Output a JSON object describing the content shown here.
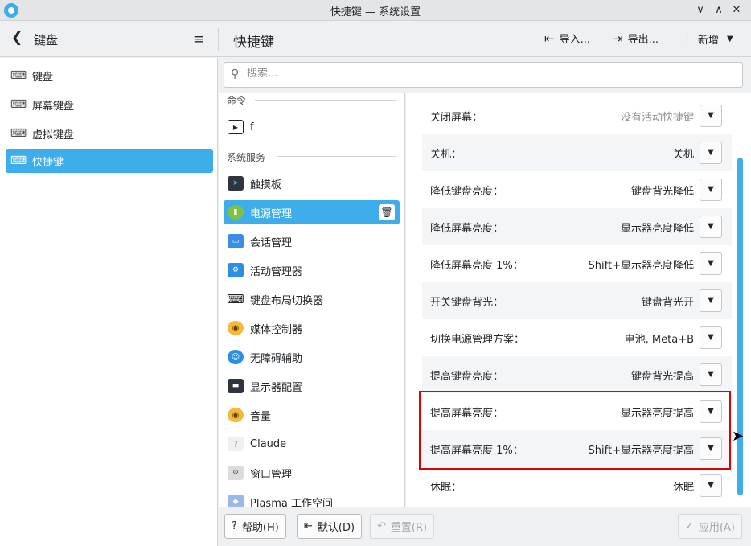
{
  "window": {
    "title": "快捷键 — 系统设置",
    "minimize": "∨",
    "maximize": "∧",
    "close": "✕"
  },
  "header": {
    "back": "❮",
    "keyboard_title": "键盘",
    "menu": "≡",
    "page_title": "快捷键",
    "import_label": "导入...",
    "export_label": "导出...",
    "new_label": "新增"
  },
  "sidebar": {
    "items": [
      {
        "label": "键盘",
        "icon": "keyboard-icon"
      },
      {
        "label": "屏幕键盘",
        "icon": "keyboard-icon"
      },
      {
        "label": "虚拟键盘",
        "icon": "keyboard-icon"
      },
      {
        "label": "快捷键",
        "icon": "keyboard-shortcut-icon"
      }
    ]
  },
  "search": {
    "placeholder": "搜索..."
  },
  "categories": {
    "group_commands": "命令",
    "command_f": "f",
    "group_services": "系统服务",
    "items": [
      {
        "label": "触摸板"
      },
      {
        "label": "电源管理"
      },
      {
        "label": "会话管理"
      },
      {
        "label": "活动管理器"
      },
      {
        "label": "键盘布局切换器"
      },
      {
        "label": "媒体控制器"
      },
      {
        "label": "无障碍辅助"
      },
      {
        "label": "显示器配置"
      },
      {
        "label": "音量"
      },
      {
        "label": "Claude"
      },
      {
        "label": "窗口管理"
      },
      {
        "label": "Plasma 工作空间"
      }
    ]
  },
  "shortcuts": [
    {
      "name": "关闭屏幕：",
      "value": "没有活动快捷键"
    },
    {
      "name": "关机：",
      "value": "关机"
    },
    {
      "name": "降低键盘亮度：",
      "value": "键盘背光降低"
    },
    {
      "name": "降低屏幕亮度：",
      "value": "显示器亮度降低"
    },
    {
      "name": "降低屏幕亮度 1%：",
      "value": "Shift+显示器亮度降低"
    },
    {
      "name": "开关键盘背光：",
      "value": "键盘背光开"
    },
    {
      "name": "切换电源管理方案：",
      "value": "电池, Meta+B"
    },
    {
      "name": "提高键盘亮度：",
      "value": "键盘背光提高"
    },
    {
      "name": "提高屏幕亮度：",
      "value": "显示器亮度提高"
    },
    {
      "name": "提高屏幕亮度 1%：",
      "value": "Shift+显示器亮度提高"
    },
    {
      "name": "休眠：",
      "value": "休眠"
    }
  ],
  "footer": {
    "help": "帮助(H)",
    "defaults": "默认(D)",
    "reset": "重置(R)",
    "apply": "应用(A)"
  },
  "colors": {
    "accent": "#3daee9",
    "highlight_border": "#e00000"
  }
}
